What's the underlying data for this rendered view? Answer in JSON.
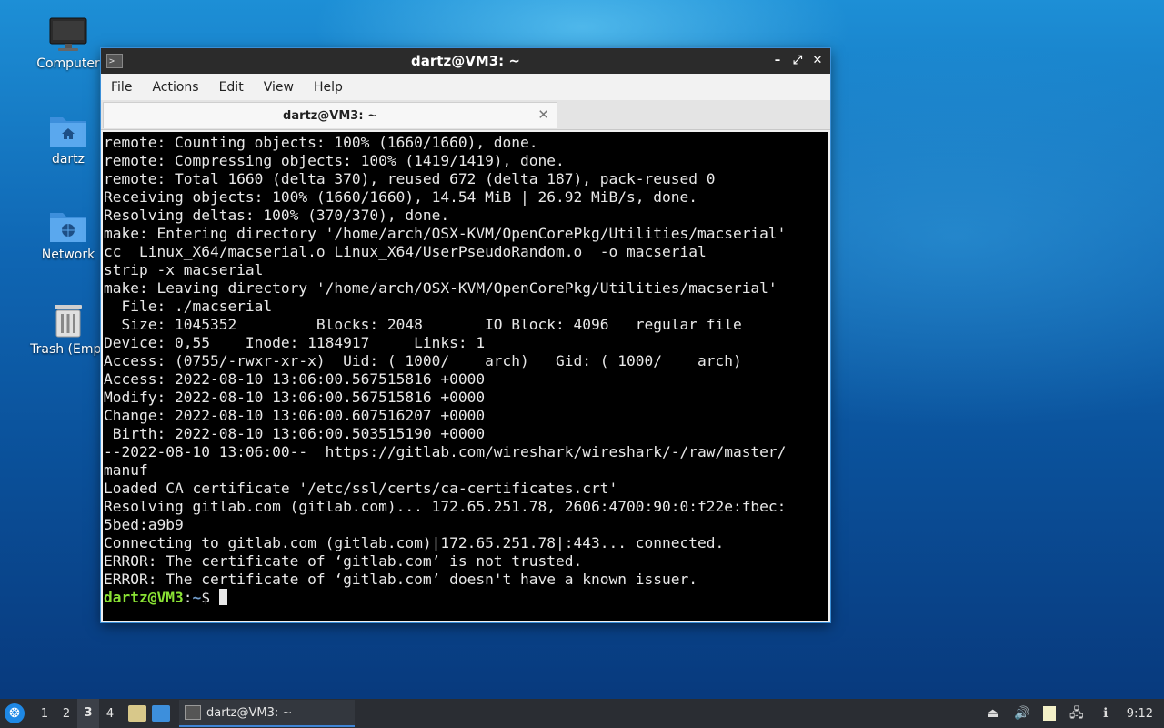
{
  "desktop": {
    "icons": [
      {
        "label": "Computer"
      },
      {
        "label": "dartz"
      },
      {
        "label": "Network"
      },
      {
        "label": "Trash (Empt"
      }
    ]
  },
  "window": {
    "title": "dartz@VM3: ~",
    "menu": [
      "File",
      "Actions",
      "Edit",
      "View",
      "Help"
    ],
    "tab_label": "dartz@VM3: ~",
    "controls": {
      "minimize": "–",
      "maximize": "⤢",
      "close": "✕"
    }
  },
  "terminal": {
    "lines": [
      "remote: Counting objects: 100% (1660/1660), done.",
      "remote: Compressing objects: 100% (1419/1419), done.",
      "remote: Total 1660 (delta 370), reused 672 (delta 187), pack-reused 0",
      "Receiving objects: 100% (1660/1660), 14.54 MiB | 26.92 MiB/s, done.",
      "Resolving deltas: 100% (370/370), done.",
      "make: Entering directory '/home/arch/OSX-KVM/OpenCorePkg/Utilities/macserial'",
      "cc  Linux_X64/macserial.o Linux_X64/UserPseudoRandom.o  -o macserial",
      "strip -x macserial",
      "make: Leaving directory '/home/arch/OSX-KVM/OpenCorePkg/Utilities/macserial'",
      "  File: ./macserial",
      "  Size: 1045352         Blocks: 2048       IO Block: 4096   regular file",
      "Device: 0,55    Inode: 1184917     Links: 1",
      "Access: (0755/-rwxr-xr-x)  Uid: ( 1000/    arch)   Gid: ( 1000/    arch)",
      "Access: 2022-08-10 13:06:00.567515816 +0000",
      "Modify: 2022-08-10 13:06:00.567515816 +0000",
      "Change: 2022-08-10 13:06:00.607516207 +0000",
      " Birth: 2022-08-10 13:06:00.503515190 +0000",
      "--2022-08-10 13:06:00--  https://gitlab.com/wireshark/wireshark/-/raw/master/",
      "manuf",
      "Loaded CA certificate '/etc/ssl/certs/ca-certificates.crt'",
      "Resolving gitlab.com (gitlab.com)... 172.65.251.78, 2606:4700:90:0:f22e:fbec:",
      "5bed:a9b9",
      "Connecting to gitlab.com (gitlab.com)|172.65.251.78|:443... connected.",
      "ERROR: The certificate of ‘gitlab.com’ is not trusted.",
      "ERROR: The certificate of ‘gitlab.com’ doesn't have a known issuer."
    ],
    "prompt": {
      "user": "dartz@VM3",
      "sep": ":",
      "path": "~",
      "symbol": "$ "
    }
  },
  "taskbar": {
    "workspaces": [
      "1",
      "2",
      "3",
      "4"
    ],
    "active_workspace": "3",
    "task_label": "dartz@VM3: ~",
    "clock": "9:12"
  },
  "colors": {
    "prompt_user": "#8ae234",
    "prompt_path": "#729fcf",
    "terminal_bg": "#000000",
    "taskbar_bg": "#2a2d33"
  }
}
